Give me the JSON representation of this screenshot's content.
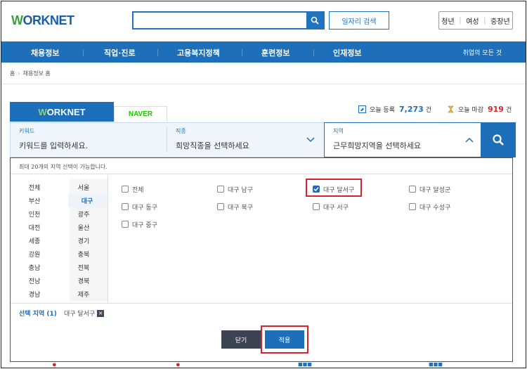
{
  "header": {
    "logo_mark": "W",
    "logo_text": "ORKNET",
    "search_placeholder": "",
    "job_search_label": "일자리 검색",
    "quick_links": [
      "청년",
      "여성",
      "중장년"
    ]
  },
  "nav": {
    "items": [
      "채용정보",
      "직업·진로",
      "고용복지정책",
      "훈련정보",
      "인재정보"
    ],
    "right_link": "취업의 모든 것"
  },
  "breadcrumb": [
    "홈",
    "채용정보 홈"
  ],
  "portal_tabs": {
    "worknet_mark": "W",
    "worknet_text": "ORKNET",
    "naver": "NAVER"
  },
  "stats": {
    "today_registered_label": "오늘 등록",
    "today_registered_count": "7,273",
    "today_registered_unit": "건",
    "today_closing_label": "오늘 마감",
    "today_closing_count": "919",
    "today_closing_unit": "건",
    "registered_color": "#1c6fb8",
    "closing_color": "#d9232c"
  },
  "search": {
    "keyword_label": "키워드",
    "keyword_placeholder": "키워드를 입력하세요.",
    "occupation_label": "직종",
    "occupation_placeholder": "희망직종을 선택하세요",
    "region_label": "지역",
    "region_placeholder": "근무희망지역을 선택하세요"
  },
  "region_popup": {
    "note": "최대 20개의 지역 선택이 가능합니다.",
    "regions_left": [
      "전체",
      "부산",
      "인천",
      "대전",
      "세종",
      "강원",
      "충남",
      "전남",
      "경남"
    ],
    "regions_right": [
      "서울",
      "대구",
      "광주",
      "울산",
      "경기",
      "충북",
      "전북",
      "경북",
      "제주"
    ],
    "selected_region": "대구",
    "subregions": [
      {
        "label": "전체",
        "checked": false
      },
      {
        "label": "대구 남구",
        "checked": false
      },
      {
        "label": "대구 달서구",
        "checked": true
      },
      {
        "label": "대구 달성군",
        "checked": false
      },
      {
        "label": "대구 동구",
        "checked": false
      },
      {
        "label": "대구 북구",
        "checked": false
      },
      {
        "label": "대구 서구",
        "checked": false
      },
      {
        "label": "대구 수성구",
        "checked": false
      },
      {
        "label": "대구 중구",
        "checked": false
      }
    ],
    "selected_label": "선택 지역 (1)",
    "selected_chip": "대구 달서구",
    "chip_remove": "×",
    "close_label": "닫기",
    "apply_label": "적용"
  },
  "accent_colors": {
    "brand_blue": "#1c6fb8",
    "highlight_red": "#d9232c"
  }
}
